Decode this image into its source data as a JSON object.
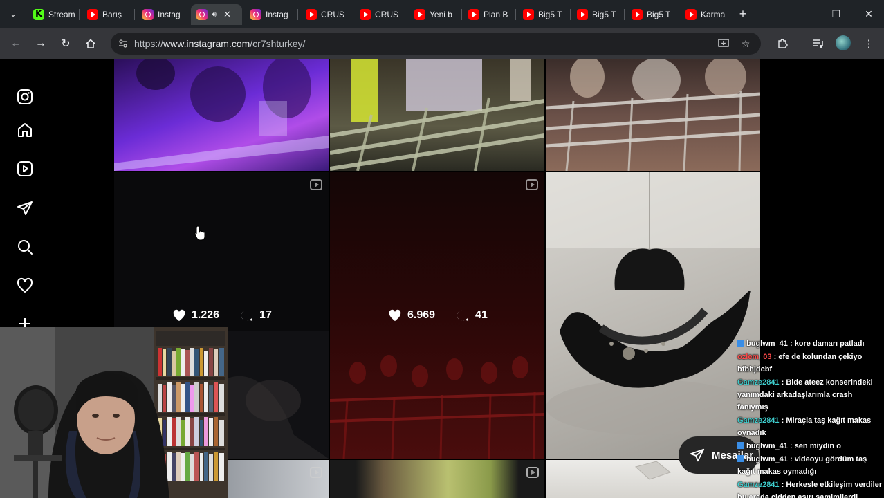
{
  "browser": {
    "tabs": [
      {
        "label": "Stream",
        "icon": "kick-icon"
      },
      {
        "label": "Barış",
        "icon": "youtube-icon"
      },
      {
        "label": "Instag",
        "icon": "instagram-icon"
      },
      {
        "label": "",
        "icon": "instagram-icon",
        "active": true
      },
      {
        "label": "Instag",
        "icon": "instagram-icon"
      },
      {
        "label": "CRUS",
        "icon": "youtube-icon"
      },
      {
        "label": "CRUS",
        "icon": "youtube-icon"
      },
      {
        "label": "Yeni b",
        "icon": "youtube-icon"
      },
      {
        "label": "Plan B",
        "icon": "youtube-icon"
      },
      {
        "label": "Big5 T",
        "icon": "youtube-icon"
      },
      {
        "label": "Big5 T",
        "icon": "youtube-icon"
      },
      {
        "label": "Big5 T",
        "icon": "youtube-icon"
      },
      {
        "label": "Karma",
        "icon": "youtube-icon"
      }
    ],
    "url_prefix": "https://",
    "url_host": "www.instagram.com",
    "url_path": "/cr7shturkey/"
  },
  "instagram": {
    "nav_icons": [
      "instagram-logo-icon",
      "home-icon",
      "reels-icon",
      "send-icon",
      "search-icon",
      "heart-icon",
      "create-icon"
    ],
    "posts": [
      {
        "likes": "1.226",
        "comments": "17"
      },
      {
        "likes": "6.969",
        "comments": "41"
      }
    ],
    "messages_label": "Mesajlar"
  },
  "chat": {
    "messages": [
      {
        "user": "buglwm_41",
        "color": "#ffffff",
        "badge": true,
        "text": "kore damarı patladı"
      },
      {
        "user": "ozlem_03",
        "color": "#ff4a4a",
        "badge": false,
        "text": "efe de kolundan çekiyo bfbhjdcbf"
      },
      {
        "user": "Gamze2841",
        "color": "#3fd0d0",
        "badge": false,
        "text": "Bide ateez konserindeki yanımdaki arkadaşlarımla crash fanıymış"
      },
      {
        "user": "Gamze2841",
        "color": "#3fd0d0",
        "badge": false,
        "text": "Miraçla taş kağıt makas oynadık"
      },
      {
        "user": "buglwm_41",
        "color": "#ffffff",
        "badge": true,
        "text": "sen miydin o"
      },
      {
        "user": "buglwm_41",
        "color": "#ffffff",
        "badge": true,
        "text": "videoyu gördüm taş kağıt makas oymadığı"
      },
      {
        "user": "Gamze2841",
        "color": "#3fd0d0",
        "badge": false,
        "text": "Herkesle etkileşim verdiler bu arada cidden aşırı samimilerdi"
      }
    ]
  }
}
